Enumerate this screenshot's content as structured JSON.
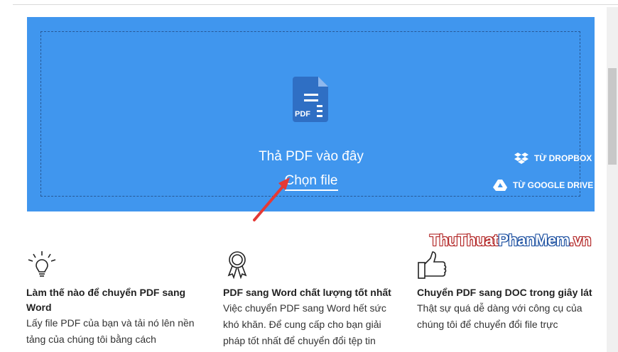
{
  "upload": {
    "drop_text": "Thả PDF vào đây",
    "choose_file": "Chọn file",
    "file_badge": "PDF",
    "dropbox_label": "TỪ DROPBOX",
    "gdrive_label": "TỪ GOOGLE DRIVE"
  },
  "watermark": {
    "part1": "ThuThuat",
    "part2": "PhanMem",
    "part3": ".vn"
  },
  "features": [
    {
      "icon": "lightbulb-icon",
      "title": "Làm thế nào để chuyển PDF sang Word",
      "text": "Lấy file PDF của bạn và tải nó lên nền tảng của chúng tôi bằng cách"
    },
    {
      "icon": "award-ribbon-icon",
      "title": "PDF sang Word chất lượng tốt nhất",
      "text": "Việc chuyển PDF sang Word hết sức khó khăn. Để cung cấp cho bạn giải pháp tốt nhất để chuyển đổi tệp tin"
    },
    {
      "icon": "thumbs-up-icon",
      "title": "Chuyển PDF sang DOC trong giây lát",
      "text": "Thật sự quá dễ dàng với công cụ của chúng tôi để chuyển đổi file trực"
    }
  ],
  "colors": {
    "drop_zone": "#4096ee",
    "annotation_arrow": "#e53935"
  }
}
